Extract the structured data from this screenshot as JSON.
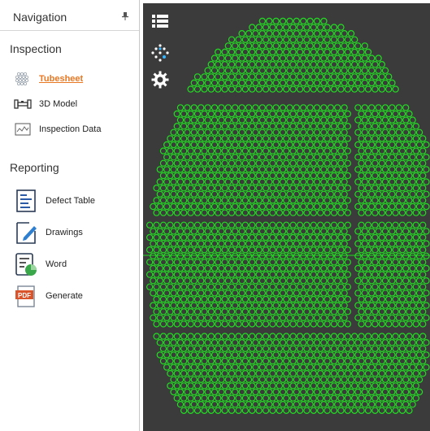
{
  "navigation": {
    "title": "Navigation",
    "inspection": {
      "heading": "Inspection",
      "items": [
        {
          "label": "Tubesheet",
          "icon": "tubesheet-icon",
          "active": true
        },
        {
          "label": "3D Model",
          "icon": "3d-model-icon",
          "active": false
        },
        {
          "label": "Inspection Data",
          "icon": "inspection-data-icon",
          "active": false
        }
      ]
    },
    "reporting": {
      "heading": "Reporting",
      "items": [
        {
          "label": "Defect Table",
          "icon": "defect-table-icon"
        },
        {
          "label": "Drawings",
          "icon": "drawings-icon"
        },
        {
          "label": "Word",
          "icon": "word-icon"
        },
        {
          "label": "Generate",
          "icon": "pdf-icon",
          "badge": "PDF"
        }
      ]
    }
  },
  "toolbar": {
    "tools": [
      "list-icon",
      "dots-icon",
      "gear-icon"
    ]
  },
  "colors": {
    "canvas": "#3b3b3b",
    "tube": "#22dd22",
    "accent": "#e87722"
  }
}
